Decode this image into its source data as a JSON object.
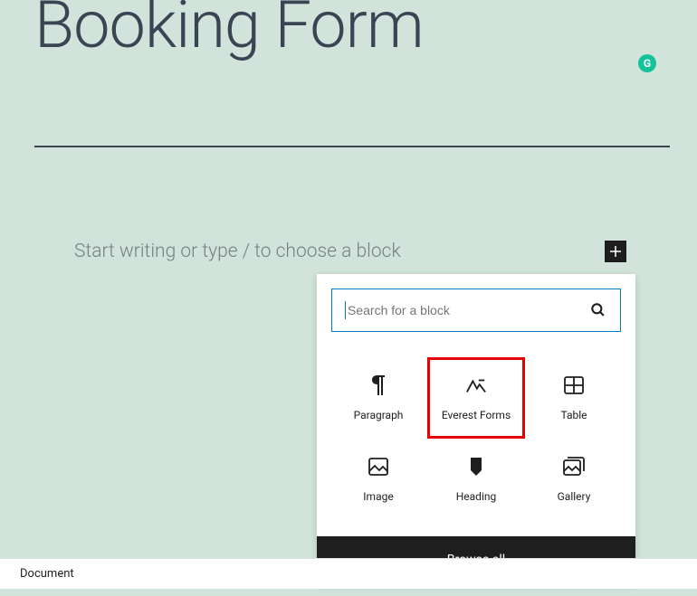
{
  "title": "Booking Form",
  "prompt": "Start writing or type / to choose a block",
  "inserter": {
    "search_placeholder": "Search for a block",
    "blocks": [
      {
        "name": "paragraph",
        "label": "Paragraph",
        "highlighted": false
      },
      {
        "name": "everest-forms",
        "label": "Everest Forms",
        "highlighted": true
      },
      {
        "name": "table",
        "label": "Table",
        "highlighted": false
      },
      {
        "name": "image",
        "label": "Image",
        "highlighted": false
      },
      {
        "name": "heading",
        "label": "Heading",
        "highlighted": false
      },
      {
        "name": "gallery",
        "label": "Gallery",
        "highlighted": false
      }
    ],
    "browse_all": "Browse all"
  },
  "footer": {
    "breadcrumb": "Document"
  }
}
